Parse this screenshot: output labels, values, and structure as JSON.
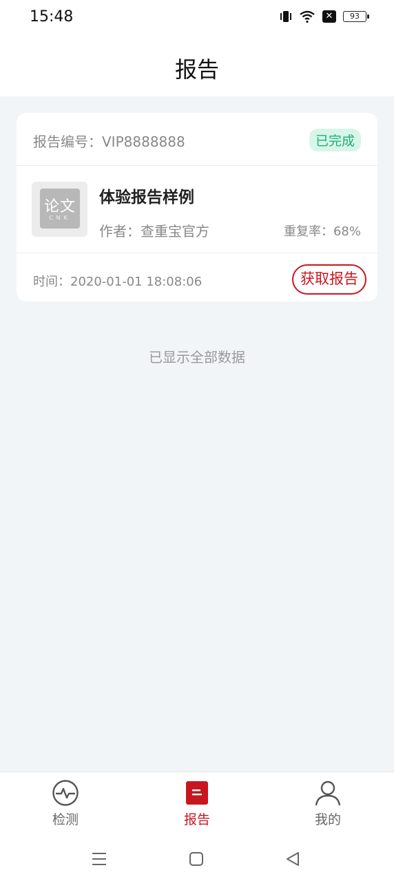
{
  "status_bar": {
    "time": "15:48",
    "battery": "93",
    "icons": [
      "vibrate-icon",
      "wifi-icon",
      "x-badge-icon",
      "battery-icon"
    ]
  },
  "header": {
    "title": "报告"
  },
  "report": {
    "number_label": "报告编号：VIP8888888",
    "status": "已完成",
    "thumbnail_logo": "论文",
    "thumbnail_sub": "CNK",
    "title": "体验报告样例",
    "author": "作者：查重宝官方",
    "rate": "重复率：68%",
    "time": "时间：2020-01-01 18:08:06",
    "action": "获取报告"
  },
  "footer_message": "已显示全部数据",
  "tab_bar": {
    "items": [
      {
        "label": "检测",
        "icon": "heartbeat-icon",
        "active": false
      },
      {
        "label": "报告",
        "icon": "report-icon",
        "active": true
      },
      {
        "label": "我的",
        "icon": "user-icon",
        "active": false
      }
    ]
  },
  "colors": {
    "accent": "#c8161e",
    "success": "#1fae73",
    "success_bg": "#d8f5ea",
    "background": "#f1f5f8"
  }
}
